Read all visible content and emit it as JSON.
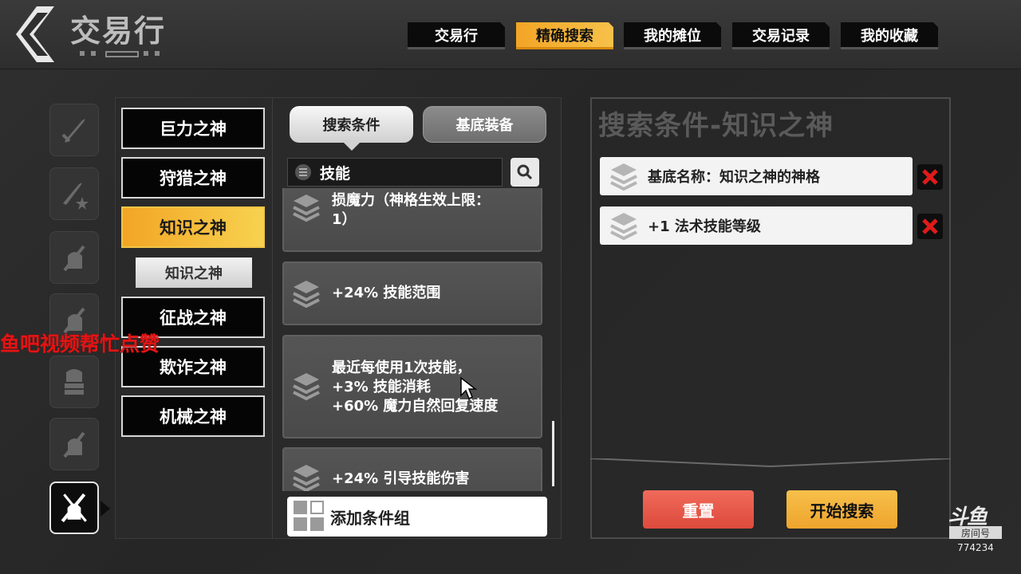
{
  "header": {
    "title": "交易行",
    "tabs": [
      {
        "label": "交易行",
        "active": false
      },
      {
        "label": "精确搜索",
        "active": true
      },
      {
        "label": "我的摊位",
        "active": false
      },
      {
        "label": "交易记录",
        "active": false
      },
      {
        "label": "我的收藏",
        "active": false
      }
    ]
  },
  "gods": {
    "items": [
      "巨力之神",
      "狩猎之神",
      "知识之神",
      "征战之神",
      "欺诈之神",
      "机械之神"
    ],
    "active": "知识之神",
    "sub_item": "知识之神"
  },
  "middle": {
    "segments": {
      "search_conditions": "搜索条件",
      "base_equipment": "基底装备"
    },
    "search_value": "技能",
    "options": [
      {
        "text": "损魔力（神格生效上限：\n1）"
      },
      {
        "text": "+24% 技能范围"
      },
      {
        "text": "最近每使用1次技能，\n+3% 技能消耗\n+60% 魔力自然回复速度"
      },
      {
        "text": "+24% 引导技能伤害"
      }
    ],
    "add_group": "添加条件组"
  },
  "right": {
    "title": "搜索条件-知识之神",
    "conditions": [
      "基底名称：知识之神的神格",
      "+1 法术技能等级"
    ],
    "reset": "重置",
    "start_search": "开始搜索"
  },
  "overlay": {
    "red_text": "鱼吧视频帮忙点赞",
    "watermark_logo": "斗鱼",
    "watermark_label": "房间号",
    "room_number": "774234"
  },
  "colors": {
    "accent": "#F3A525",
    "danger": "#E04C3E",
    "delete_x": "#E01A1A"
  }
}
